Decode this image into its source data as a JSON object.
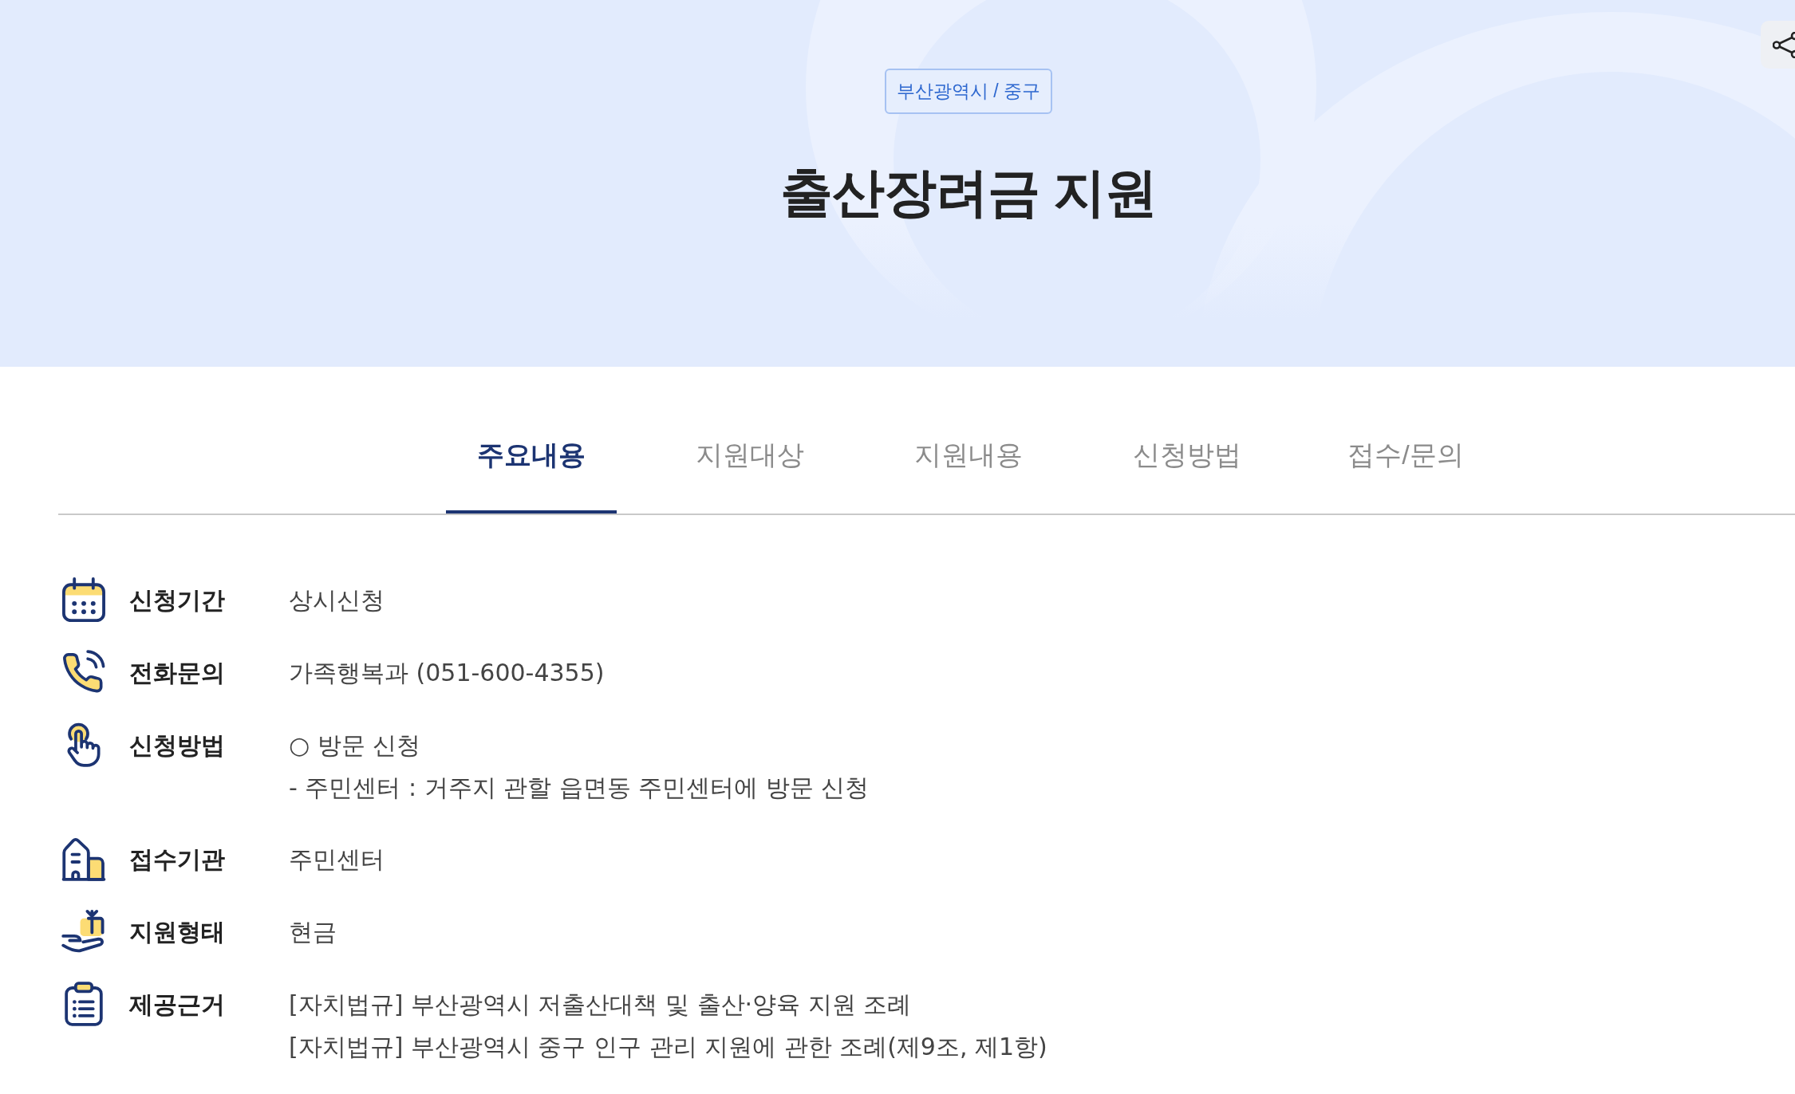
{
  "header": {
    "region_badge": "부산광역시 / 중구",
    "title": "출산장려금 지원"
  },
  "tabs": [
    {
      "label": "주요내용",
      "selected": true
    },
    {
      "label": "지원대상",
      "selected": false
    },
    {
      "label": "지원내용",
      "selected": false
    },
    {
      "label": "신청방법",
      "selected": false
    },
    {
      "label": "접수/문의",
      "selected": false
    }
  ],
  "details": [
    {
      "label": "신청기간",
      "lines": [
        "상시신청"
      ]
    },
    {
      "label": "전화문의",
      "lines": [
        "가족행복과 (051-600-4355)"
      ]
    },
    {
      "label": "신청방법",
      "lines": [
        "○ 방문 신청",
        "- 주민센터 : 거주지 관할 읍면동 주민센터에 방문 신청"
      ]
    },
    {
      "label": "접수기관",
      "lines": [
        "주민센터"
      ]
    },
    {
      "label": "지원형태",
      "lines": [
        "현금"
      ]
    },
    {
      "label": "제공근거",
      "lines": [
        "[자치법규] 부산광역시 저출산대책 및 출산·양육 지원 조례",
        "[자치법규] 부산광역시 중구 인구 관리 지원에 관한 조례(제9조, 제1항)"
      ]
    }
  ]
}
